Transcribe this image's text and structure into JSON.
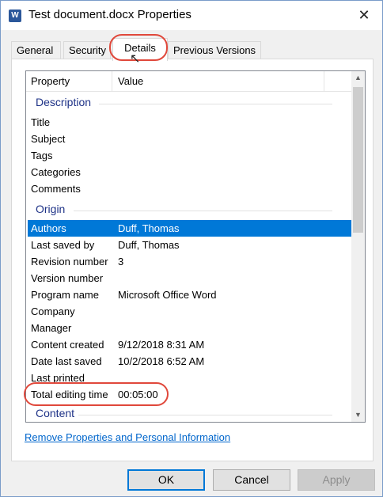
{
  "window": {
    "title": "Test document.docx Properties",
    "icon_name": "word-document-icon",
    "icon_glyph": "W",
    "close_glyph": "✕"
  },
  "tabs": [
    {
      "label": "General"
    },
    {
      "label": "Security"
    },
    {
      "label": "Details",
      "active": true
    },
    {
      "label": "Previous Versions"
    }
  ],
  "list": {
    "column_property": "Property",
    "column_value": "Value",
    "groups": {
      "description": "Description",
      "origin": "Origin",
      "content": "Content"
    },
    "description_rows": [
      {
        "property": "Title",
        "value": ""
      },
      {
        "property": "Subject",
        "value": ""
      },
      {
        "property": "Tags",
        "value": ""
      },
      {
        "property": "Categories",
        "value": ""
      },
      {
        "property": "Comments",
        "value": ""
      }
    ],
    "origin_rows": [
      {
        "property": "Authors",
        "value": "Duff, Thomas",
        "selected": true
      },
      {
        "property": "Last saved by",
        "value": "Duff, Thomas"
      },
      {
        "property": "Revision number",
        "value": "3"
      },
      {
        "property": "Version number",
        "value": ""
      },
      {
        "property": "Program name",
        "value": "Microsoft Office Word"
      },
      {
        "property": "Company",
        "value": ""
      },
      {
        "property": "Manager",
        "value": ""
      },
      {
        "property": "Content created",
        "value": "9/12/2018 8:31 AM"
      },
      {
        "property": "Date last saved",
        "value": "10/2/2018 6:52 AM"
      },
      {
        "property": "Last printed",
        "value": ""
      },
      {
        "property": "Total editing time",
        "value": "00:05:00"
      }
    ],
    "scroll_up_glyph": "▲",
    "scroll_down_glyph": "▼"
  },
  "link_text": "Remove Properties and Personal Information",
  "buttons": {
    "ok": "OK",
    "cancel": "Cancel",
    "apply": "Apply"
  },
  "cursor_glyph": "↖",
  "colors": {
    "selection": "#0078d7",
    "group_header": "#1e3287",
    "annotation": "#e0483b",
    "link": "#0066cc"
  }
}
